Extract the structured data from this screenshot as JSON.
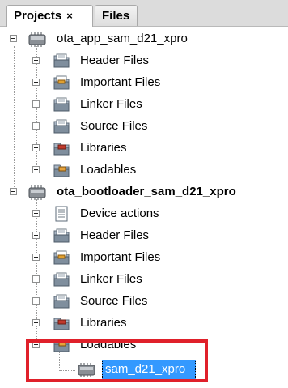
{
  "tabs": [
    {
      "label": "Projects",
      "close": "×",
      "active": true
    },
    {
      "label": "Files",
      "active": false
    }
  ],
  "tree": {
    "project1": {
      "name": "ota_app_sam_d21_xpro",
      "children": [
        "Header Files",
        "Important Files",
        "Linker Files",
        "Source Files",
        "Libraries",
        "Loadables"
      ]
    },
    "project2": {
      "name": "ota_bootloader_sam_d21_xpro",
      "children": [
        "Device actions",
        "Header Files",
        "Important Files",
        "Linker Files",
        "Source Files",
        "Libraries",
        "Loadables"
      ],
      "loadable_item": "sam_d21_xpro"
    }
  },
  "colors": {
    "selection": "#3399ff",
    "callout_border": "#e0202a"
  },
  "icons": {
    "project": "chip-project-icon",
    "folder": "logical-folder-icon",
    "device_actions": "document-list-icon",
    "chip": "chip-icon"
  }
}
